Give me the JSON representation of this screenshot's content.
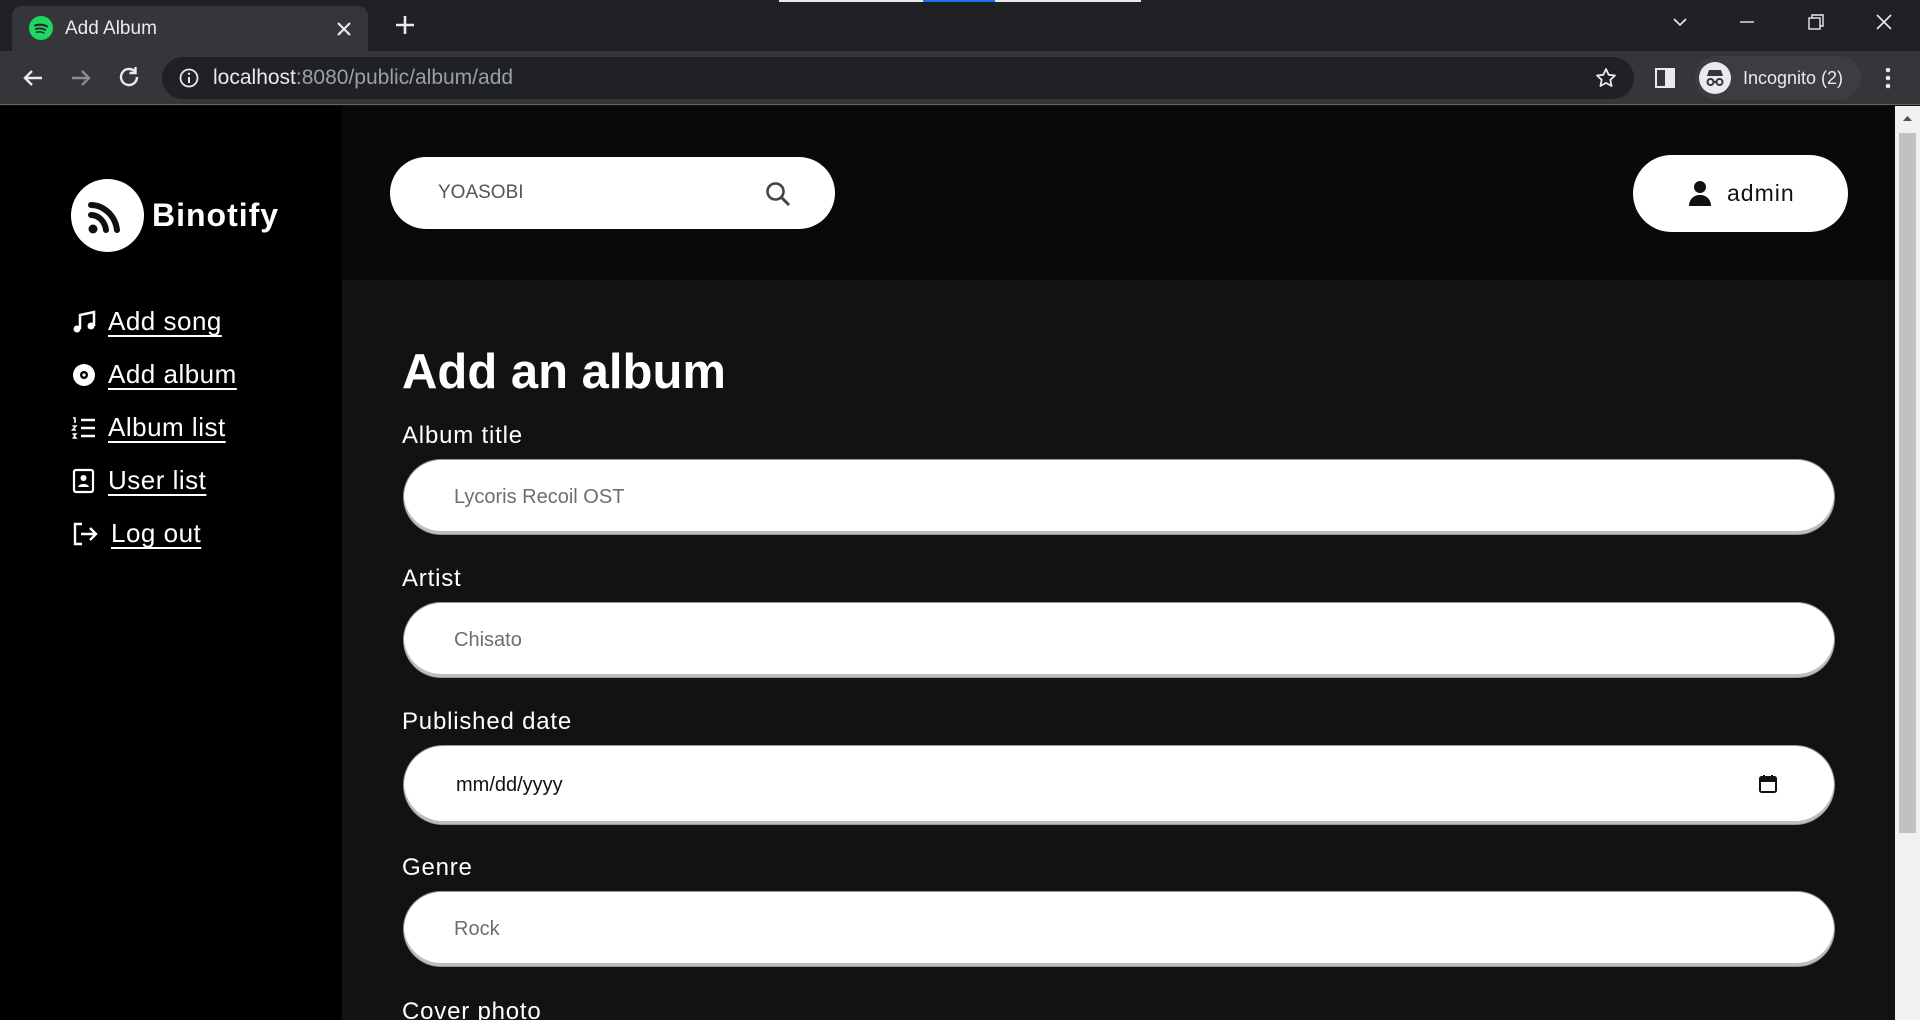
{
  "browser": {
    "tab_title": "Add Album",
    "url_host": "localhost",
    "url_path": ":8080/public/album/add",
    "profile_label": "Incognito (2)"
  },
  "sidebar": {
    "brand": "Binotify",
    "items": [
      {
        "label": "Add song",
        "icon": "music-note-icon"
      },
      {
        "label": "Add album",
        "icon": "disc-icon"
      },
      {
        "label": "Album list",
        "icon": "numbered-list-icon"
      },
      {
        "label": "User list",
        "icon": "contact-card-icon"
      },
      {
        "label": "Log out",
        "icon": "logout-icon"
      }
    ]
  },
  "header": {
    "search_value": "YOASOBI",
    "user_name": "admin"
  },
  "form": {
    "title": "Add an album",
    "fields": [
      {
        "label": "Album title",
        "value": "Lycoris Recoil OST"
      },
      {
        "label": "Artist",
        "value": "Chisato"
      },
      {
        "label": "Published date",
        "value": "mm/dd/yyyy"
      },
      {
        "label": "Genre",
        "value": "Rock"
      },
      {
        "label": "Cover photo"
      }
    ]
  },
  "colors": {
    "accent": "#1ed760",
    "sidebar_bg": "#000000",
    "page_bg": "#121212"
  }
}
